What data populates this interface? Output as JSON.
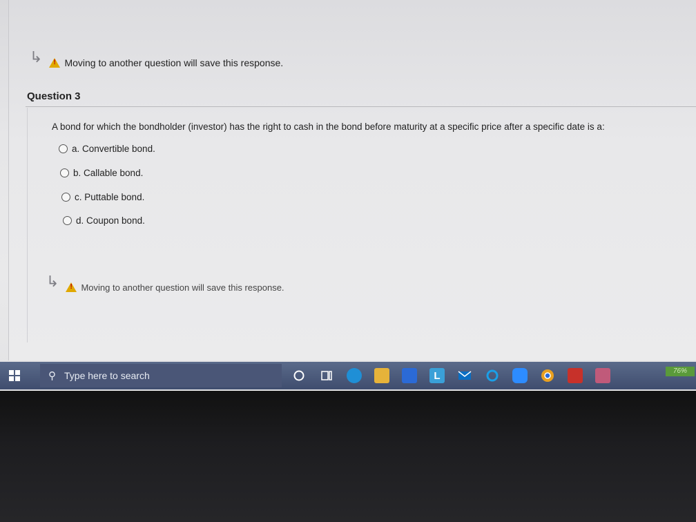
{
  "notice": {
    "top_text": "Moving to another question will save this response.",
    "bottom_text": "Moving to another question will save this response."
  },
  "question": {
    "title": "Question 3",
    "text": "A bond for which the bondholder (investor) has the right to cash in the bond before maturity at a specific price after a specific date is a:",
    "options": [
      {
        "label": "a. Convertible bond."
      },
      {
        "label": "b. Callable bond."
      },
      {
        "label": "c. Puttable bond."
      },
      {
        "label": "d. Coupon bond."
      }
    ]
  },
  "taskbar": {
    "search_placeholder": "Type here to search",
    "battery": "76%",
    "icons": [
      "cortana-icon",
      "task-view-icon",
      "edge-icon",
      "file-explorer-icon",
      "store-icon",
      "lens-app-icon",
      "mail-icon",
      "circle-app-icon",
      "zoom-icon",
      "chrome-icon",
      "among-us-icon",
      "photos-icon"
    ],
    "colors": {
      "edge": "#1f8fd6",
      "explorer": "#e6b33a",
      "store": "#2b6ad6",
      "lens": "#3aa0d8",
      "mail": "#0a6fc4",
      "zoom": "#2d8cff",
      "chrome": "#e8a020",
      "among": "#c7312a",
      "photos": "#c05a7a"
    }
  }
}
